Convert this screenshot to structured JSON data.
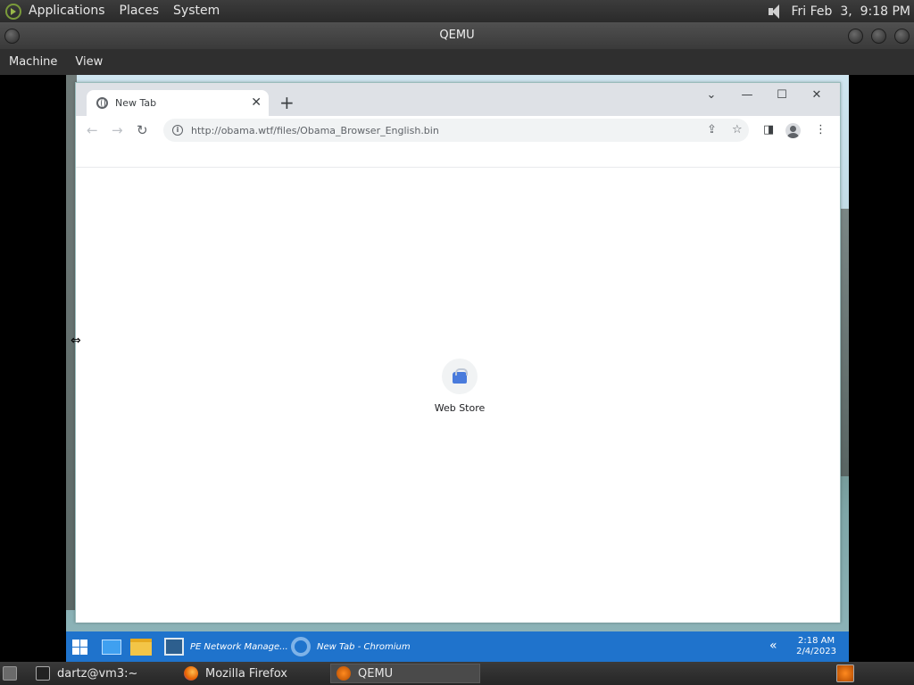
{
  "top_panel": {
    "menus": [
      "Applications",
      "Places",
      "System"
    ],
    "clock": "Fri Feb  3,  9:18 PM"
  },
  "qemu": {
    "title": "QEMU",
    "menus": [
      "Machine",
      "View"
    ]
  },
  "browser": {
    "tab_title": "New Tab",
    "url": "http://obama.wtf/files/Obama_Browser_English.bin",
    "shortcut_label": "Web Store"
  },
  "taskbar": {
    "apps": [
      {
        "label": "PE Network Manage..."
      },
      {
        "label": "New Tab - Chromium"
      }
    ],
    "time": "2:18 AM",
    "date": "2/4/2023"
  },
  "bottom_panel": {
    "items": [
      "dartz@vm3:~",
      "Mozilla Firefox",
      "QEMU"
    ]
  },
  "icons": {
    "globe": "globe-icon",
    "back": "back-arrow-icon",
    "forward": "forward-arrow-icon",
    "reload": "reload-icon",
    "info": "info-icon",
    "share": "share-icon",
    "star": "star-icon",
    "side_panel": "side-panel-icon",
    "profile": "profile-icon",
    "menu": "kebab-menu-icon"
  },
  "colors": {
    "taskbar": "#1f73cc",
    "tabstrip": "#dee1e6",
    "omnibox": "#f1f3f4"
  }
}
